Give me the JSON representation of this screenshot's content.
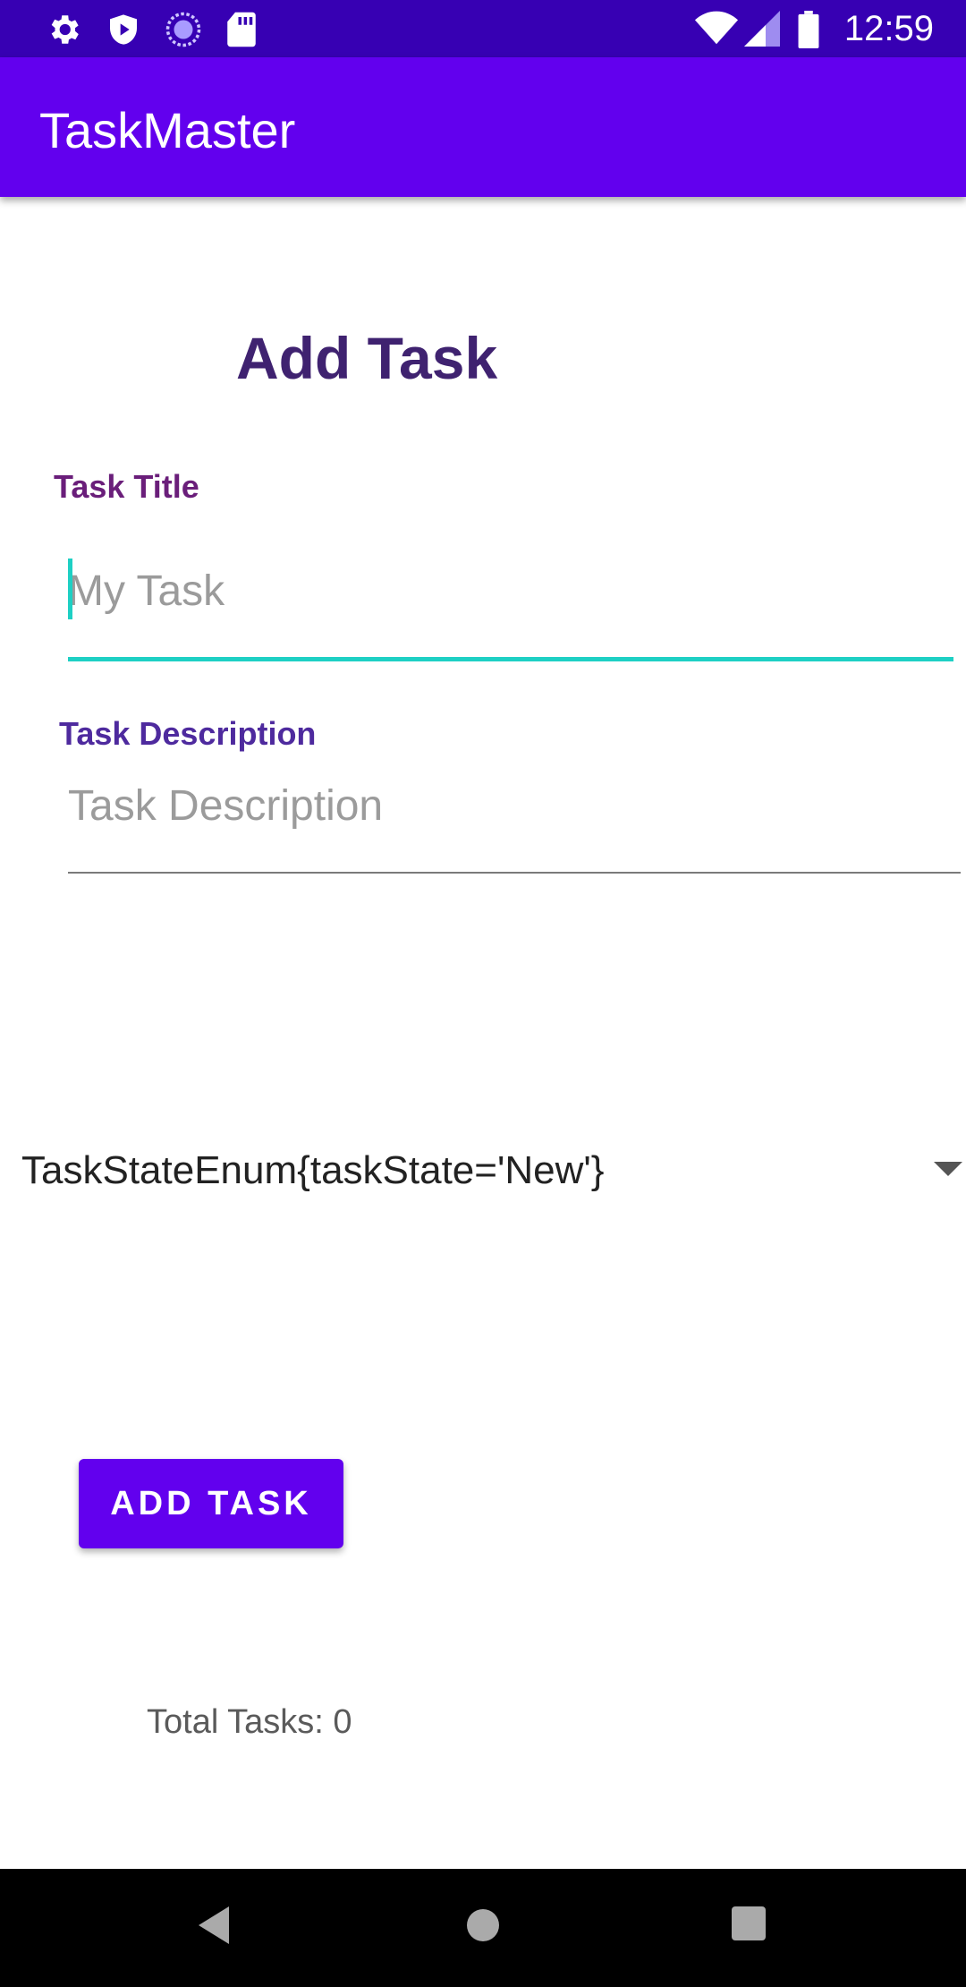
{
  "status_bar": {
    "time": "12:59",
    "left_icons": [
      "gear-icon",
      "play-protect-icon",
      "sync-circle-icon",
      "sd-card-icon"
    ],
    "right_icons": [
      "wifi-icon",
      "cell-signal-icon",
      "battery-icon"
    ]
  },
  "app_bar": {
    "title": "TaskMaster"
  },
  "form": {
    "heading": "Add Task",
    "title_label": "Task Title",
    "title_placeholder": "My Task",
    "title_value": "",
    "description_label": "Task Description",
    "description_placeholder": "Task Description",
    "description_value": "",
    "state_selected": "TaskStateEnum{taskState='New'}",
    "submit_label": "ADD TASK",
    "total_tasks": "Total Tasks: 0"
  },
  "colors": {
    "status_bar": "#3700B3",
    "app_bar": "#6200EE",
    "accent": "#1ED0C4",
    "heading": "#3F2270"
  },
  "nav_bar": {
    "buttons": [
      "back-icon",
      "home-icon",
      "recents-icon"
    ]
  }
}
